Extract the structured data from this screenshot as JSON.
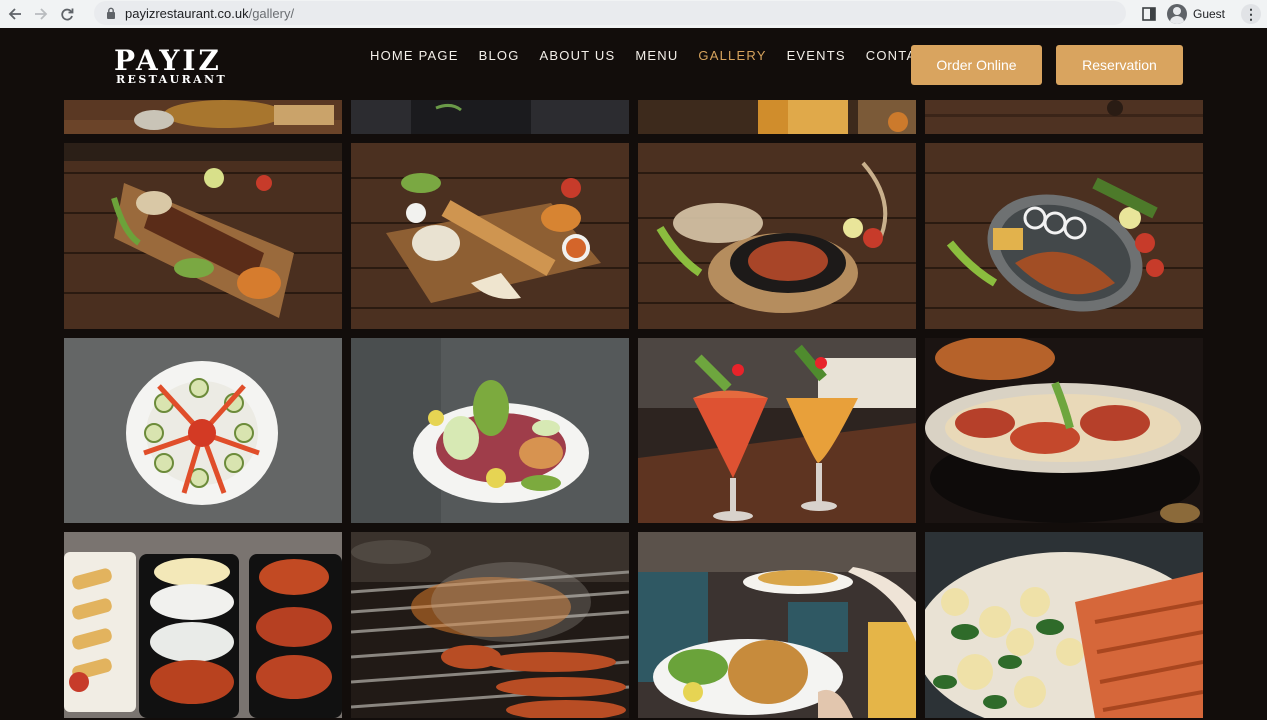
{
  "browser": {
    "url_host": "payizrestaurant.co.uk",
    "url_path": "/gallery/",
    "profile_label": "Guest"
  },
  "site": {
    "logo_main": "PAYIZ",
    "logo_sub": "RESTAURANT",
    "nav": [
      {
        "label": "HOME PAGE"
      },
      {
        "label": "BLOG"
      },
      {
        "label": "ABOUT US"
      },
      {
        "label": "MENU"
      },
      {
        "label": "GALLERY",
        "active": true
      },
      {
        "label": "EVENTS"
      },
      {
        "label": "CONTACT"
      }
    ],
    "order_button": "Order Online",
    "reservation_button": "Reservation",
    "accent_color": "#d9a45f",
    "nav_active_color": "#d6a35d"
  },
  "gallery": {
    "tiles": [
      {
        "name": "gallery-image-top-1"
      },
      {
        "name": "gallery-image-top-2"
      },
      {
        "name": "gallery-image-top-3"
      },
      {
        "name": "gallery-image-top-4"
      },
      {
        "name": "gallery-image-mixed-grill-board"
      },
      {
        "name": "gallery-image-wrap-kebab-board"
      },
      {
        "name": "gallery-image-sizzling-plate"
      },
      {
        "name": "gallery-image-grilled-fish-plate"
      },
      {
        "name": "gallery-image-cucumber-salad"
      },
      {
        "name": "gallery-image-shepherd-salad"
      },
      {
        "name": "gallery-image-cocktails"
      },
      {
        "name": "gallery-image-manti-plate"
      },
      {
        "name": "gallery-image-meze-platters"
      },
      {
        "name": "gallery-image-charcoal-grill"
      },
      {
        "name": "gallery-image-waiter-serving"
      },
      {
        "name": "gallery-image-salmon-potatoes"
      }
    ]
  }
}
